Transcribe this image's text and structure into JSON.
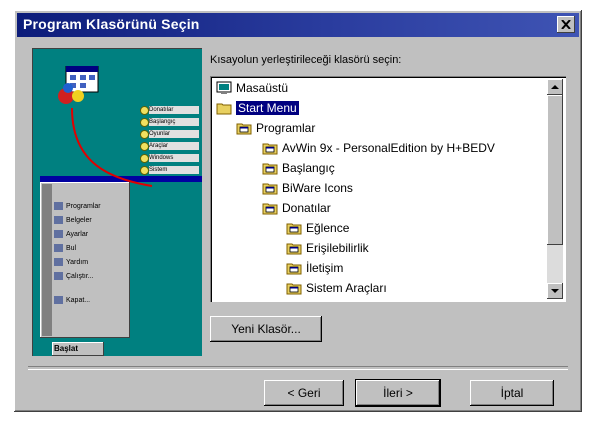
{
  "window": {
    "title": "Program Klasörünü Seçin",
    "close_icon": "close-icon"
  },
  "illustration": {
    "folder_labels": [
      "Donatılar",
      "Başlangıç",
      "Oyunlar",
      "Araçlar",
      "Windows",
      "Sistem"
    ],
    "menu_labels": [
      "Programlar",
      "Belgeler",
      "Ayarlar",
      "Bul",
      "Yardım",
      "Çalıştır...",
      "Kapat..."
    ],
    "start_label": "Başlat"
  },
  "prompt": {
    "label": "Kısayolun yerleştirileceği klasörü seçin:"
  },
  "tree": {
    "items": [
      {
        "label": "Masaüstü",
        "icon": "desktop-icon",
        "selected": false
      },
      {
        "label": "Start Menu",
        "icon": "folder-icon",
        "selected": true
      },
      {
        "label": "Programlar",
        "icon": "program-group-icon",
        "selected": false
      },
      {
        "label": "AvWin 9x - PersonalEdition by H+BEDV",
        "icon": "program-group-icon",
        "selected": false
      },
      {
        "label": "Başlangıç",
        "icon": "program-group-icon",
        "selected": false
      },
      {
        "label": "BiWare Icons",
        "icon": "program-group-icon",
        "selected": false
      },
      {
        "label": "Donatılar",
        "icon": "program-group-icon",
        "selected": false
      },
      {
        "label": "Eğlence",
        "icon": "program-group-icon",
        "selected": false
      },
      {
        "label": "Erişilebilirlik",
        "icon": "program-group-icon",
        "selected": false
      },
      {
        "label": "İletişim",
        "icon": "program-group-icon",
        "selected": false
      },
      {
        "label": "Sistem Araçları",
        "icon": "program-group-icon",
        "selected": false
      }
    ]
  },
  "buttons": {
    "new_folder": "Yeni Klasör...",
    "back": "< Geri",
    "next": "İleri >",
    "cancel": "İptal"
  },
  "colors": {
    "titlebar": "#0c1c7a",
    "selection": "#000080",
    "illustration_bg": "#008080",
    "face": "#c0c0c0"
  }
}
